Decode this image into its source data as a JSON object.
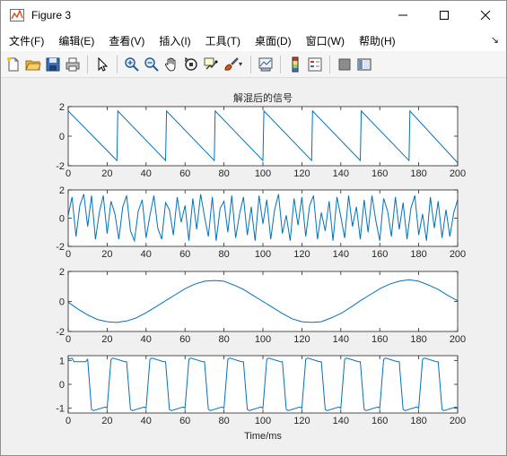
{
  "window": {
    "title": "Figure 3",
    "controls": [
      "minimize-icon",
      "maximize-icon",
      "close-icon"
    ]
  },
  "menubar": {
    "items": [
      "文件(F)",
      "编辑(E)",
      "查看(V)",
      "插入(I)",
      "工具(T)",
      "桌面(D)",
      "窗口(W)",
      "帮助(H)"
    ]
  },
  "toolbar": {
    "buttons": [
      "new-figure-icon",
      "open-file-icon",
      "save-icon",
      "print-icon",
      "select-arrow-icon",
      "zoom-in-icon",
      "zoom-out-icon",
      "pan-hand-icon",
      "rotate-3d-icon",
      "data-cursor-icon",
      "brush-icon",
      "link-plot-icon",
      "colorbar-icon",
      "legend-icon",
      "hide-plot-tools-icon",
      "show-plot-tools-icon"
    ]
  },
  "colors": {
    "line": "#0072BD",
    "axes_bg": "#ffffff",
    "figure_bg": "#f0f0f0"
  },
  "figure": {
    "title": "解混后的信号",
    "xlabel": "Time/ms"
  },
  "chart_data": [
    {
      "type": "line",
      "title": "解混后的信号",
      "xlabel": "",
      "ylabel": "",
      "xlim": [
        0,
        200
      ],
      "ylim": [
        -2,
        2
      ],
      "xticks": [
        0,
        20,
        40,
        60,
        80,
        100,
        120,
        140,
        160,
        180,
        200
      ],
      "yticks": [
        -2,
        0,
        2
      ],
      "grid": false,
      "description_signal": "sawtooth",
      "series": [
        {
          "x": [
            0,
            25,
            25.5,
            50,
            50.5,
            75,
            75.5,
            100,
            100.5,
            125,
            125.5,
            150,
            150.5,
            175,
            175.5,
            200
          ],
          "y": [
            1.7,
            -1.65,
            1.7,
            -1.65,
            1.7,
            -1.65,
            1.7,
            -1.65,
            1.7,
            -1.65,
            1.7,
            -1.65,
            1.7,
            -1.65,
            1.7,
            -1.8
          ]
        }
      ]
    },
    {
      "type": "line",
      "title": "",
      "xlabel": "",
      "ylabel": "",
      "xlim": [
        0,
        200
      ],
      "ylim": [
        -2,
        2
      ],
      "xticks": [
        0,
        20,
        40,
        60,
        80,
        100,
        120,
        140,
        160,
        180,
        200
      ],
      "yticks": [
        -2,
        0,
        2
      ],
      "grid": false,
      "series": [
        {
          "x": [
            0,
            2,
            4,
            6,
            8,
            10,
            12,
            14,
            16,
            18,
            20,
            22,
            24,
            26,
            28,
            30,
            32,
            34,
            36,
            38,
            40,
            42,
            44,
            46,
            48,
            50,
            52,
            54,
            56,
            58,
            60,
            62,
            64,
            66,
            68,
            70,
            72,
            74,
            76,
            78,
            80,
            82,
            84,
            86,
            88,
            90,
            92,
            94,
            96,
            98,
            100,
            102,
            104,
            106,
            108,
            110,
            112,
            114,
            116,
            118,
            120,
            122,
            124,
            126,
            128,
            130,
            132,
            134,
            136,
            138,
            140,
            142,
            144,
            146,
            148,
            150,
            152,
            154,
            156,
            158,
            160,
            162,
            164,
            166,
            168,
            170,
            172,
            174,
            176,
            178,
            180,
            182,
            184,
            186,
            188,
            190,
            192,
            194,
            196,
            198,
            200
          ],
          "y": [
            0.2,
            1.5,
            -1.3,
            0.9,
            1.7,
            -0.6,
            1.6,
            -1.5,
            0.4,
            1.6,
            -1.1,
            1.2,
            0.3,
            -1.5,
            0.8,
            1.6,
            -0.9,
            -1.6,
            0.5,
            1.3,
            -1.4,
            0.2,
            1.6,
            -0.7,
            -1.5,
            1.1,
            0.6,
            -1.2,
            1.5,
            -0.3,
            0.9,
            -1.6,
            1.4,
            -0.8,
            1.7,
            0.1,
            -1.3,
            1.5,
            -1.6,
            0.7,
            1.2,
            -1.0,
            1.6,
            -1.4,
            0.3,
            1.5,
            -1.2,
            0.8,
            -1.6,
            1.6,
            -0.4,
            1.3,
            -1.5,
            0.6,
            1.7,
            -1.1,
            0.2,
            -1.6,
            1.4,
            -0.5,
            1.5,
            -1.3,
            0.9,
            1.6,
            -1.5,
            0.4,
            -0.9,
            1.2,
            -1.6,
            1.5,
            0.1,
            -1.4,
            1.6,
            -0.6,
            0.8,
            -1.5,
            1.3,
            -1.0,
            1.6,
            -0.2,
            -1.6,
            1.4,
            0.5,
            -1.3,
            1.5,
            -0.8,
            1.1,
            -1.5,
            0.7,
            1.6,
            -1.2,
            0.3,
            -1.6,
            1.5,
            -0.7,
            1.2,
            -1.4,
            0.6,
            -1.3,
            0.4,
            1.3
          ]
        }
      ]
    },
    {
      "type": "line",
      "title": "",
      "xlabel": "",
      "ylabel": "",
      "xlim": [
        0,
        200
      ],
      "ylim": [
        -2,
        2
      ],
      "xticks": [
        0,
        20,
        40,
        60,
        80,
        100,
        120,
        140,
        160,
        180,
        200
      ],
      "yticks": [
        -2,
        0,
        2
      ],
      "grid": false,
      "series": [
        {
          "x": [
            0,
            5,
            10,
            15,
            20,
            25,
            30,
            35,
            40,
            45,
            50,
            55,
            60,
            65,
            70,
            75,
            80,
            85,
            90,
            95,
            100,
            105,
            110,
            115,
            120,
            125,
            130,
            135,
            140,
            145,
            150,
            155,
            160,
            165,
            170,
            175,
            180,
            185,
            190,
            195,
            200
          ],
          "y": [
            -0.05,
            -0.5,
            -0.9,
            -1.2,
            -1.35,
            -1.4,
            -1.3,
            -1.1,
            -0.75,
            -0.35,
            0.05,
            0.45,
            0.85,
            1.15,
            1.35,
            1.4,
            1.35,
            1.1,
            0.8,
            0.4,
            0.0,
            -0.4,
            -0.8,
            -1.15,
            -1.35,
            -1.4,
            -1.35,
            -1.1,
            -0.8,
            -0.4,
            0.05,
            0.45,
            0.85,
            1.15,
            1.35,
            1.45,
            1.35,
            1.1,
            0.8,
            0.4,
            0.05
          ]
        }
      ]
    },
    {
      "type": "line",
      "title": "",
      "xlabel": "Time/ms",
      "ylabel": "",
      "xlim": [
        0,
        200
      ],
      "ylim": [
        -1.2,
        1.2
      ],
      "xticks": [
        0,
        20,
        40,
        60,
        80,
        100,
        120,
        140,
        160,
        180,
        200
      ],
      "yticks": [
        -1,
        0,
        1
      ],
      "grid": false,
      "description_signal": "square-like",
      "series": [
        {
          "x": [
            0,
            2,
            3,
            9,
            10,
            12,
            13,
            19,
            20,
            22,
            23,
            29,
            30,
            32,
            33,
            39,
            40,
            42,
            43,
            49,
            50,
            52,
            53,
            59,
            60,
            62,
            63,
            69,
            70,
            72,
            73,
            79,
            80,
            82,
            83,
            89,
            90,
            92,
            93,
            99,
            100,
            102,
            103,
            109,
            110,
            112,
            113,
            119,
            120,
            122,
            123,
            129,
            130,
            132,
            133,
            139,
            140,
            142,
            143,
            149,
            150,
            152,
            153,
            159,
            160,
            162,
            163,
            169,
            170,
            172,
            173,
            179,
            180,
            182,
            183,
            189,
            190,
            192,
            193,
            199,
            200
          ],
          "y": [
            1.05,
            1.1,
            0.95,
            0.95,
            1.05,
            -1.05,
            -1.1,
            -0.95,
            -1.0,
            1.05,
            1.1,
            0.95,
            0.95,
            -1.05,
            -1.1,
            -0.95,
            -1.0,
            1.05,
            1.1,
            0.95,
            0.95,
            -1.05,
            -1.1,
            -0.95,
            -1.0,
            1.05,
            1.1,
            0.95,
            0.95,
            -1.05,
            -1.1,
            -0.95,
            -1.0,
            1.05,
            1.1,
            0.95,
            0.95,
            -1.05,
            -1.1,
            -0.95,
            -1.0,
            1.05,
            1.1,
            0.95,
            0.95,
            -1.05,
            -1.1,
            -0.95,
            -1.0,
            1.05,
            1.1,
            0.95,
            0.95,
            -1.05,
            -1.1,
            -0.95,
            -1.0,
            1.05,
            1.1,
            0.95,
            0.95,
            -1.05,
            -1.1,
            -0.95,
            -1.0,
            1.05,
            1.1,
            0.95,
            0.95,
            -1.05,
            -1.1,
            -0.95,
            -1.0,
            1.05,
            1.1,
            0.95,
            0.95,
            -1.05,
            -1.1,
            -0.95,
            -1.0
          ]
        }
      ]
    }
  ]
}
